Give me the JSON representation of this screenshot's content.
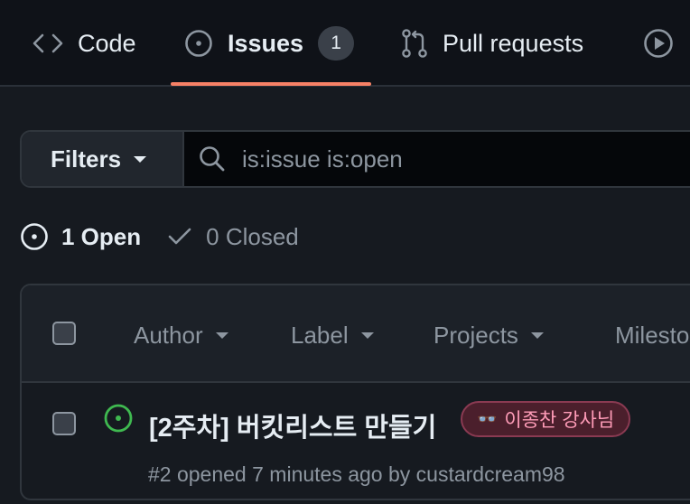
{
  "repo_tabs": [
    {
      "label": "Code",
      "icon": "code-icon"
    },
    {
      "label": "Issues",
      "icon": "issue-opened-icon",
      "count": "1",
      "selected": true
    },
    {
      "label": "Pull requests",
      "icon": "git-pull-request-icon"
    },
    {
      "label": "",
      "icon": "play-icon"
    }
  ],
  "filters": {
    "button_label": "Filters",
    "search_value": "is:issue is:open"
  },
  "states": {
    "open_label": "1 Open",
    "closed_label": "0 Closed"
  },
  "table_header": {
    "author": "Author",
    "label": "Label",
    "projects": "Projects",
    "milestones": "Milesto"
  },
  "issues": [
    {
      "title": "[2주차] 버킷리스트 만들기",
      "label": {
        "text": "이종찬 강사님",
        "emoji": "👓",
        "color": "#ff9cb8"
      },
      "meta": "#2 opened 7 minutes ago by custardcream98"
    }
  ],
  "colors": {
    "accent_underline": "#f78166",
    "open_green": "#3fb950",
    "background": "#161a20"
  }
}
